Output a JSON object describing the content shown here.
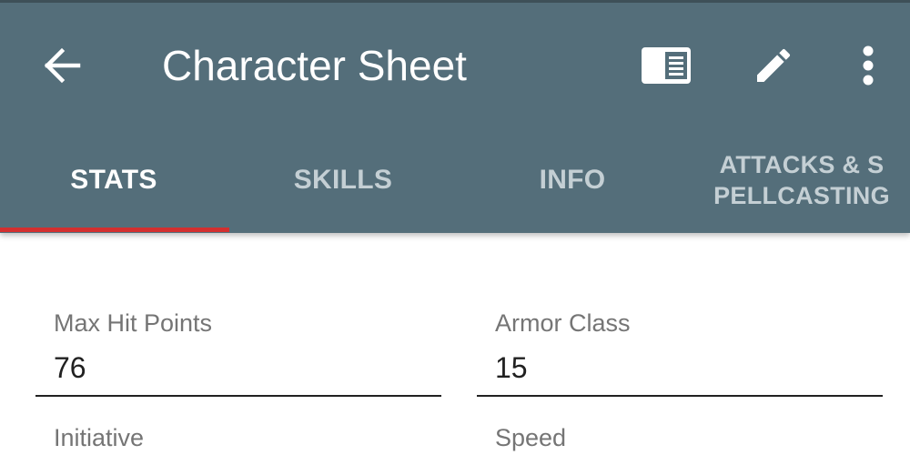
{
  "toolbar": {
    "title": "Character Sheet",
    "back_icon": "arrow-back-icon",
    "actions": [
      {
        "name": "book-view-icon"
      },
      {
        "name": "edit-pencil-icon"
      },
      {
        "name": "more-vert-icon"
      }
    ]
  },
  "tabs": [
    {
      "label": "STATS",
      "active": true
    },
    {
      "label": "SKILLS",
      "active": false
    },
    {
      "label": "INFO",
      "active": false
    },
    {
      "label_line1": "ATTACKS & S",
      "label_line2": "PELLCASTING",
      "active": false
    }
  ],
  "colors": {
    "appbar": "#546e7a",
    "indicator": "#d32f2f",
    "inactive_tab_text": "#c4cfd4"
  },
  "fields": [
    {
      "label": "Max Hit Points",
      "value": "76"
    },
    {
      "label": "Armor Class",
      "value": "15"
    },
    {
      "label": "Initiative",
      "value": ""
    },
    {
      "label": "Speed",
      "value": ""
    }
  ]
}
